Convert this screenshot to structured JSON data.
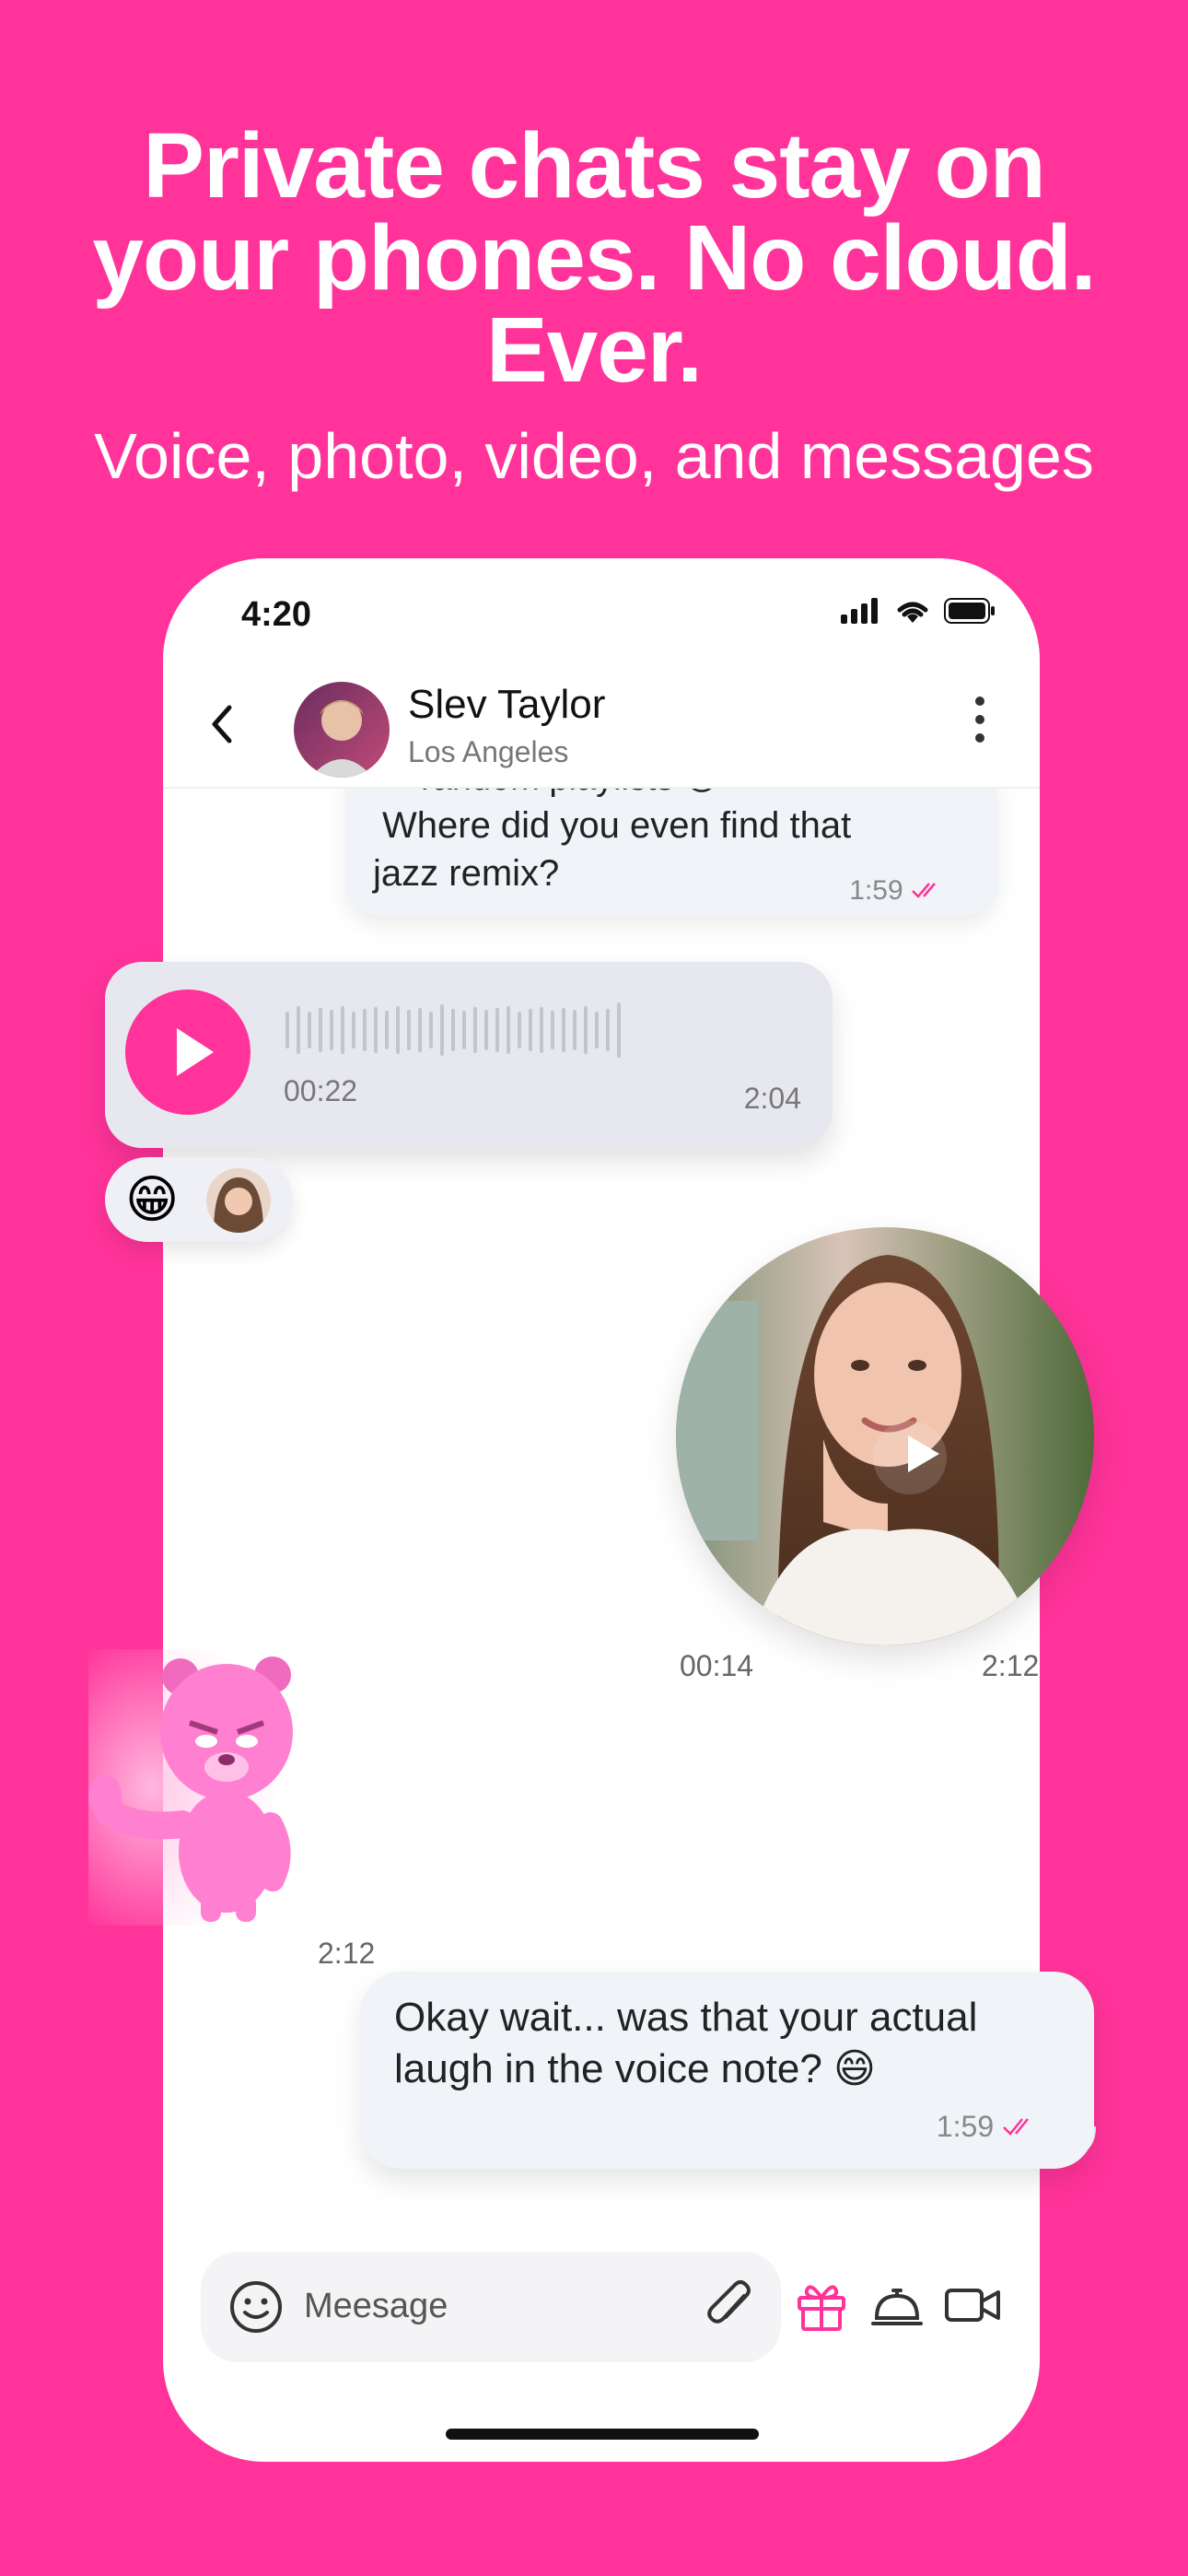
{
  "promo": {
    "headline_lines": [
      "Private chats stay on",
      "your phones. No cloud.",
      "Ever."
    ],
    "subline": "Voice, photo, video, and messages"
  },
  "status_bar": {
    "time": "4:20"
  },
  "chat_header": {
    "name": "Slev Taylor",
    "location": "Los Angeles"
  },
  "messages": {
    "top_bubble_partial": "random playlists 😅",
    "top_bubble_lines": [
      "Where did you even find that",
      "jazz remix?"
    ],
    "top_bubble_time": "1:59",
    "voice_elapsed": "00:22",
    "voice_time": "2:04",
    "reaction_emoji": "😁",
    "video_elapsed": "00:14",
    "video_time": "2:12",
    "sticker_time": "2:12",
    "bottom_bubble_text": "Okay wait... was that your actual laugh in the voice note? 😄",
    "bottom_bubble_time": "1:59"
  },
  "composer": {
    "placeholder": "Meesage"
  },
  "colors": {
    "brand": "#ff3399",
    "bubble": "#f0f3f8",
    "voice_bubble": "#e7e8ef"
  },
  "icons": [
    "chevron-left-icon",
    "more-vertical-icon",
    "play-icon",
    "smile-icon",
    "paperclip-icon",
    "gift-icon",
    "service-bell-icon",
    "video-camera-icon",
    "signal-icon",
    "wifi-icon",
    "battery-icon",
    "double-check-icon"
  ]
}
